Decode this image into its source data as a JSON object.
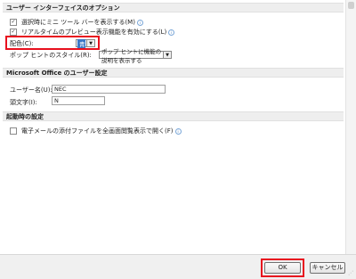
{
  "sections": {
    "ui_options": "ユーザー インターフェイスのオプション",
    "office_user": "Microsoft Office のユーザー設定",
    "startup": "起動時の設定"
  },
  "ui_options": {
    "mini_toolbar": {
      "label": "選択時にミニ ツール バーを表示する(M)",
      "checked": true
    },
    "live_preview": {
      "label": "リアルタイムのプレビュー表示機能を有効にする(L)",
      "checked": true
    },
    "color_scheme": {
      "label": "配色(C):",
      "value": "青"
    },
    "screentip_style": {
      "label": "ポップ ヒントのスタイル(R):",
      "value": "ポップ ヒントに機能の説明を表示する"
    }
  },
  "office_user": {
    "username_label": "ユーザー名(U):",
    "username_value": "NEC",
    "initials_label": "頭文字(I):",
    "initials_value": "N"
  },
  "startup": {
    "fullscreen_reading": {
      "label": "電子メールの添付ファイルを全画面閲覧表示で開く(F)",
      "checked": false
    }
  },
  "buttons": {
    "ok": "OK",
    "cancel": "キャンセル"
  },
  "icons": {
    "info": "info-icon",
    "dropdown": "chevron-down-icon",
    "check": "check-icon"
  },
  "colors": {
    "highlight": "#e8101e",
    "section_bg": "#eeeeee",
    "footer_bg": "#f0f0f0"
  }
}
